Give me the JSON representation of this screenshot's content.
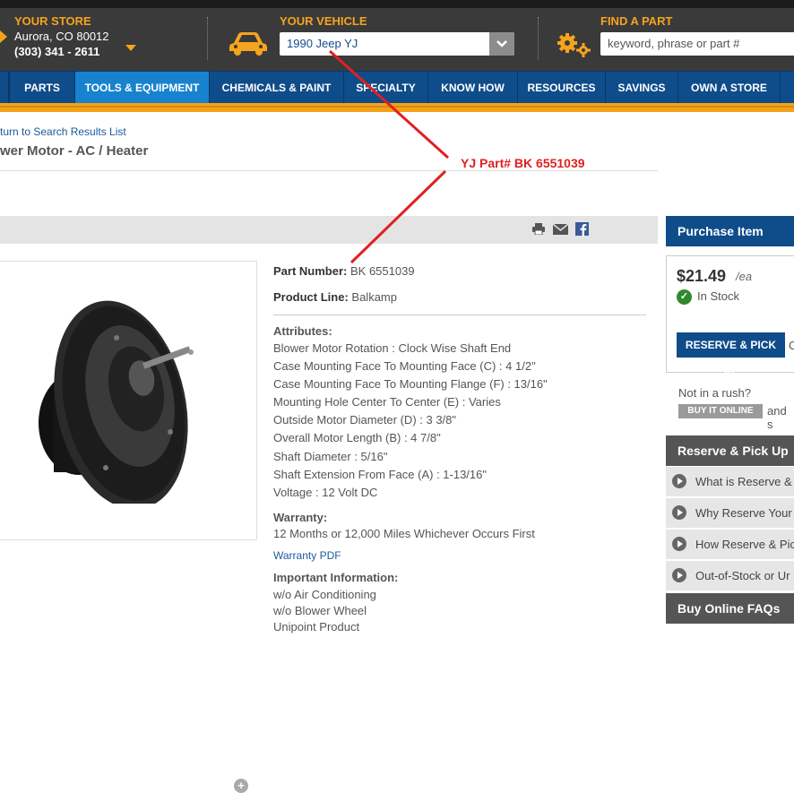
{
  "header": {
    "store": {
      "label": "YOUR STORE",
      "address": "Aurora, CO 80012",
      "phone": "(303) 341 - 2611"
    },
    "vehicle": {
      "label": "YOUR VEHICLE",
      "selected": "1990 Jeep YJ"
    },
    "find": {
      "label": "FIND A PART",
      "placeholder": "keyword, phrase or part #"
    }
  },
  "nav": [
    "PARTS",
    "TOOLS & EQUIPMENT",
    "CHEMICALS & PAINT",
    "SPECIALTY",
    "KNOW HOW",
    "RESOURCES",
    "SAVINGS",
    "OWN A STORE"
  ],
  "breadcrumb": {
    "back": "turn to Search Results List"
  },
  "product": {
    "title": "wer Motor - AC / Heater",
    "part_number_label": "Part Number:",
    "part_number": "BK 6551039",
    "product_line_label": "Product Line:",
    "product_line": "Balkamp",
    "attributes_label": "Attributes:",
    "attributes": [
      "Blower Motor Rotation : Clock Wise Shaft End",
      "Case Mounting Face To Mounting Face (C) : 4 1/2\"",
      "Case Mounting Face To Mounting Flange (F) : 13/16\"",
      "Mounting Hole Center To Center (E) : Varies",
      "Outside Motor Diameter (D) : 3 3/8\"",
      "Overall Motor Length (B) : 4 7/8\"",
      "Shaft Diameter : 5/16\"",
      "Shaft Extension From Face (A) : 1-13/16\"",
      "Voltage : 12 Volt DC"
    ],
    "warranty_label": "Warranty:",
    "warranty": "12 Months or 12,000 Miles Whichever Occurs First",
    "warranty_pdf": "Warranty PDF",
    "important_label": "Important Information:",
    "important": [
      "w/o Air Conditioning",
      "w/o Blower Wheel",
      "Unipoint Product"
    ]
  },
  "purchase": {
    "title": "Purchase Item",
    "price": "$21.49",
    "unit": "/ea",
    "stock": "In Stock",
    "reserve_button": "RESERVE & PICK UP",
    "reserve_after": "C",
    "rush": "Not in a rush?",
    "buy_online": "BUY IT ONLINE",
    "buy_after": "and s"
  },
  "reserve_faq": {
    "title": "Reserve & Pick Up",
    "items": [
      "What is Reserve &",
      "Why Reserve Your",
      "How Reserve & Pic",
      "Out-of-Stock or Ur"
    ]
  },
  "buy_faq": {
    "title": "Buy Online FAQs"
  },
  "annotation": "YJ Part# BK 6551039",
  "colors": {
    "brand_blue": "#0f4c8a",
    "accent_orange": "#f5a41d",
    "annotation_red": "#e02020"
  }
}
